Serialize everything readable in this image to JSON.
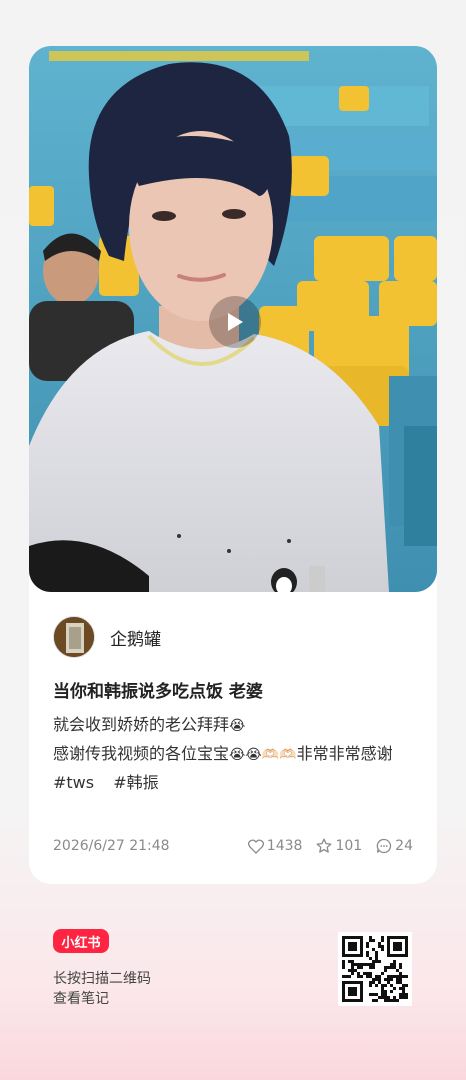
{
  "note": {
    "author_name": "企鹅罐",
    "title": "当你和韩振说多吃点饭 老婆",
    "desc_line1": "就会收到娇娇的老公拜拜",
    "desc_line2": "感谢传我视频的各位宝宝",
    "desc_line2_suffix": "非常非常感谢",
    "tags": [
      "#tws",
      "#韩振"
    ],
    "date": "2026/6/27 21:48",
    "likes": "1438",
    "collects": "101",
    "comments": "24"
  },
  "footer": {
    "badge": "小红书",
    "line1": "长按扫描二维码",
    "line2": "查看笔记"
  },
  "colors": {
    "brand": "#ff2442",
    "seat_yellow": "#f2c233",
    "seat_blue": "#4ea7c7"
  },
  "icons": {
    "play": "play-icon",
    "like": "heart-icon",
    "collect": "star-icon",
    "comment": "comment-icon"
  }
}
